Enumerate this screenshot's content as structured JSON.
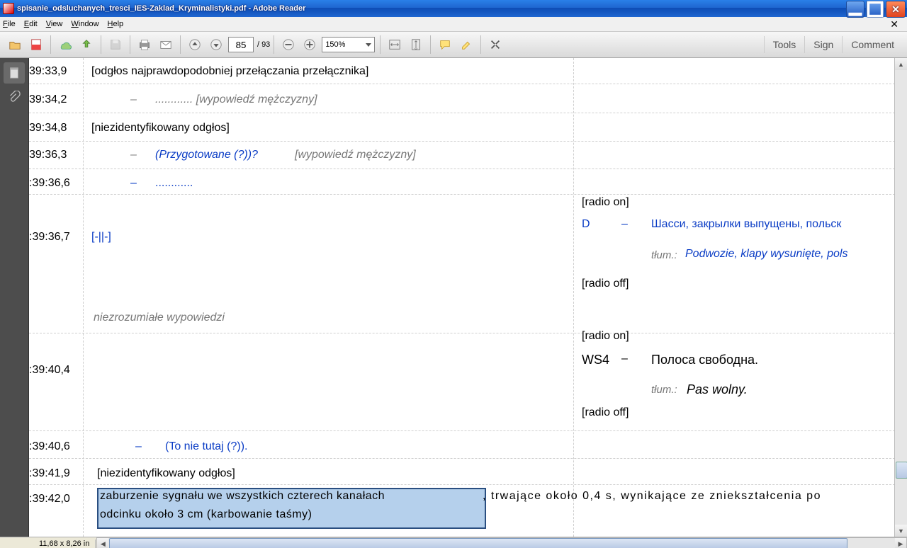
{
  "window": {
    "title": "spisanie_odsluchanych_tresci_IES-Zaklad_Kryminalistyki.pdf - Adobe Reader"
  },
  "menu": {
    "file": "File",
    "edit": "Edit",
    "view": "View",
    "window": "Window",
    "help": "Help"
  },
  "toolbar": {
    "page_current": "85",
    "page_sep": "/",
    "page_total": "93",
    "zoom": "150%",
    "tools": "Tools",
    "sign": "Sign",
    "comment": "Comment"
  },
  "rows": [
    {
      "ts": "39:33,9",
      "text": "[odgłos najprawdopodobniej przełączania przełącznika]",
      "cls": ""
    },
    {
      "ts": "39:34,2",
      "dash": "–",
      "text": "............ [wypowiedź mężczyzny]",
      "cls": "it"
    },
    {
      "ts": "39:34,8",
      "text": "[niezidentyfikowany odgłos]",
      "cls": ""
    },
    {
      "ts": "39:36,3",
      "dash": "–",
      "preblue": "(Przygotowane (?))? ",
      "text": "[wypowiedź mężczyzny]",
      "cls": "it"
    },
    {
      "ts": ":39:36,6",
      "dash": "–",
      "text": "............",
      "cls": "blue"
    }
  ],
  "mid": {
    "ts": ":39:36,7",
    "mark": "[-||-]",
    "radio_on": "[radio on]",
    "d": "D",
    "d_dash": "–",
    "d_text": "Шасси, закрылки выпущены, польск",
    "tlum": "tłum.:",
    "tlum_text": "Podwozie, klapy wysunięte, pols",
    "niezroz": "niezrozumiałe wypowiedzi",
    "radio_off": "[radio off]"
  },
  "ws": {
    "ts": ":39:40,4",
    "radio_on": "[radio on]",
    "ws4": "WS4",
    "dash": "–",
    "text": "Полоса свободна.",
    "tlum": "tłum.:",
    "tlum_text": "Pas wolny.",
    "radio_off": "[radio off]"
  },
  "lower": {
    "ts406": ":39:40,6",
    "dash": "–",
    "text406": "(To nie tutaj (?)).",
    "ts419": ":39:41,9",
    "text419": "[niezidentyfikowany odgłos]",
    "ts420": ":39:42,0",
    "text420a": "zaburzenie sygnału we wszystkich czterech kanałach",
    "text420b": ", trwające około 0,4 s, wynikające ze zniekształcenia po",
    "text420c": "odcinku około 3 cm (karbowanie taśmy)"
  },
  "status": {
    "dim": "11,68 x 8,26 in"
  }
}
